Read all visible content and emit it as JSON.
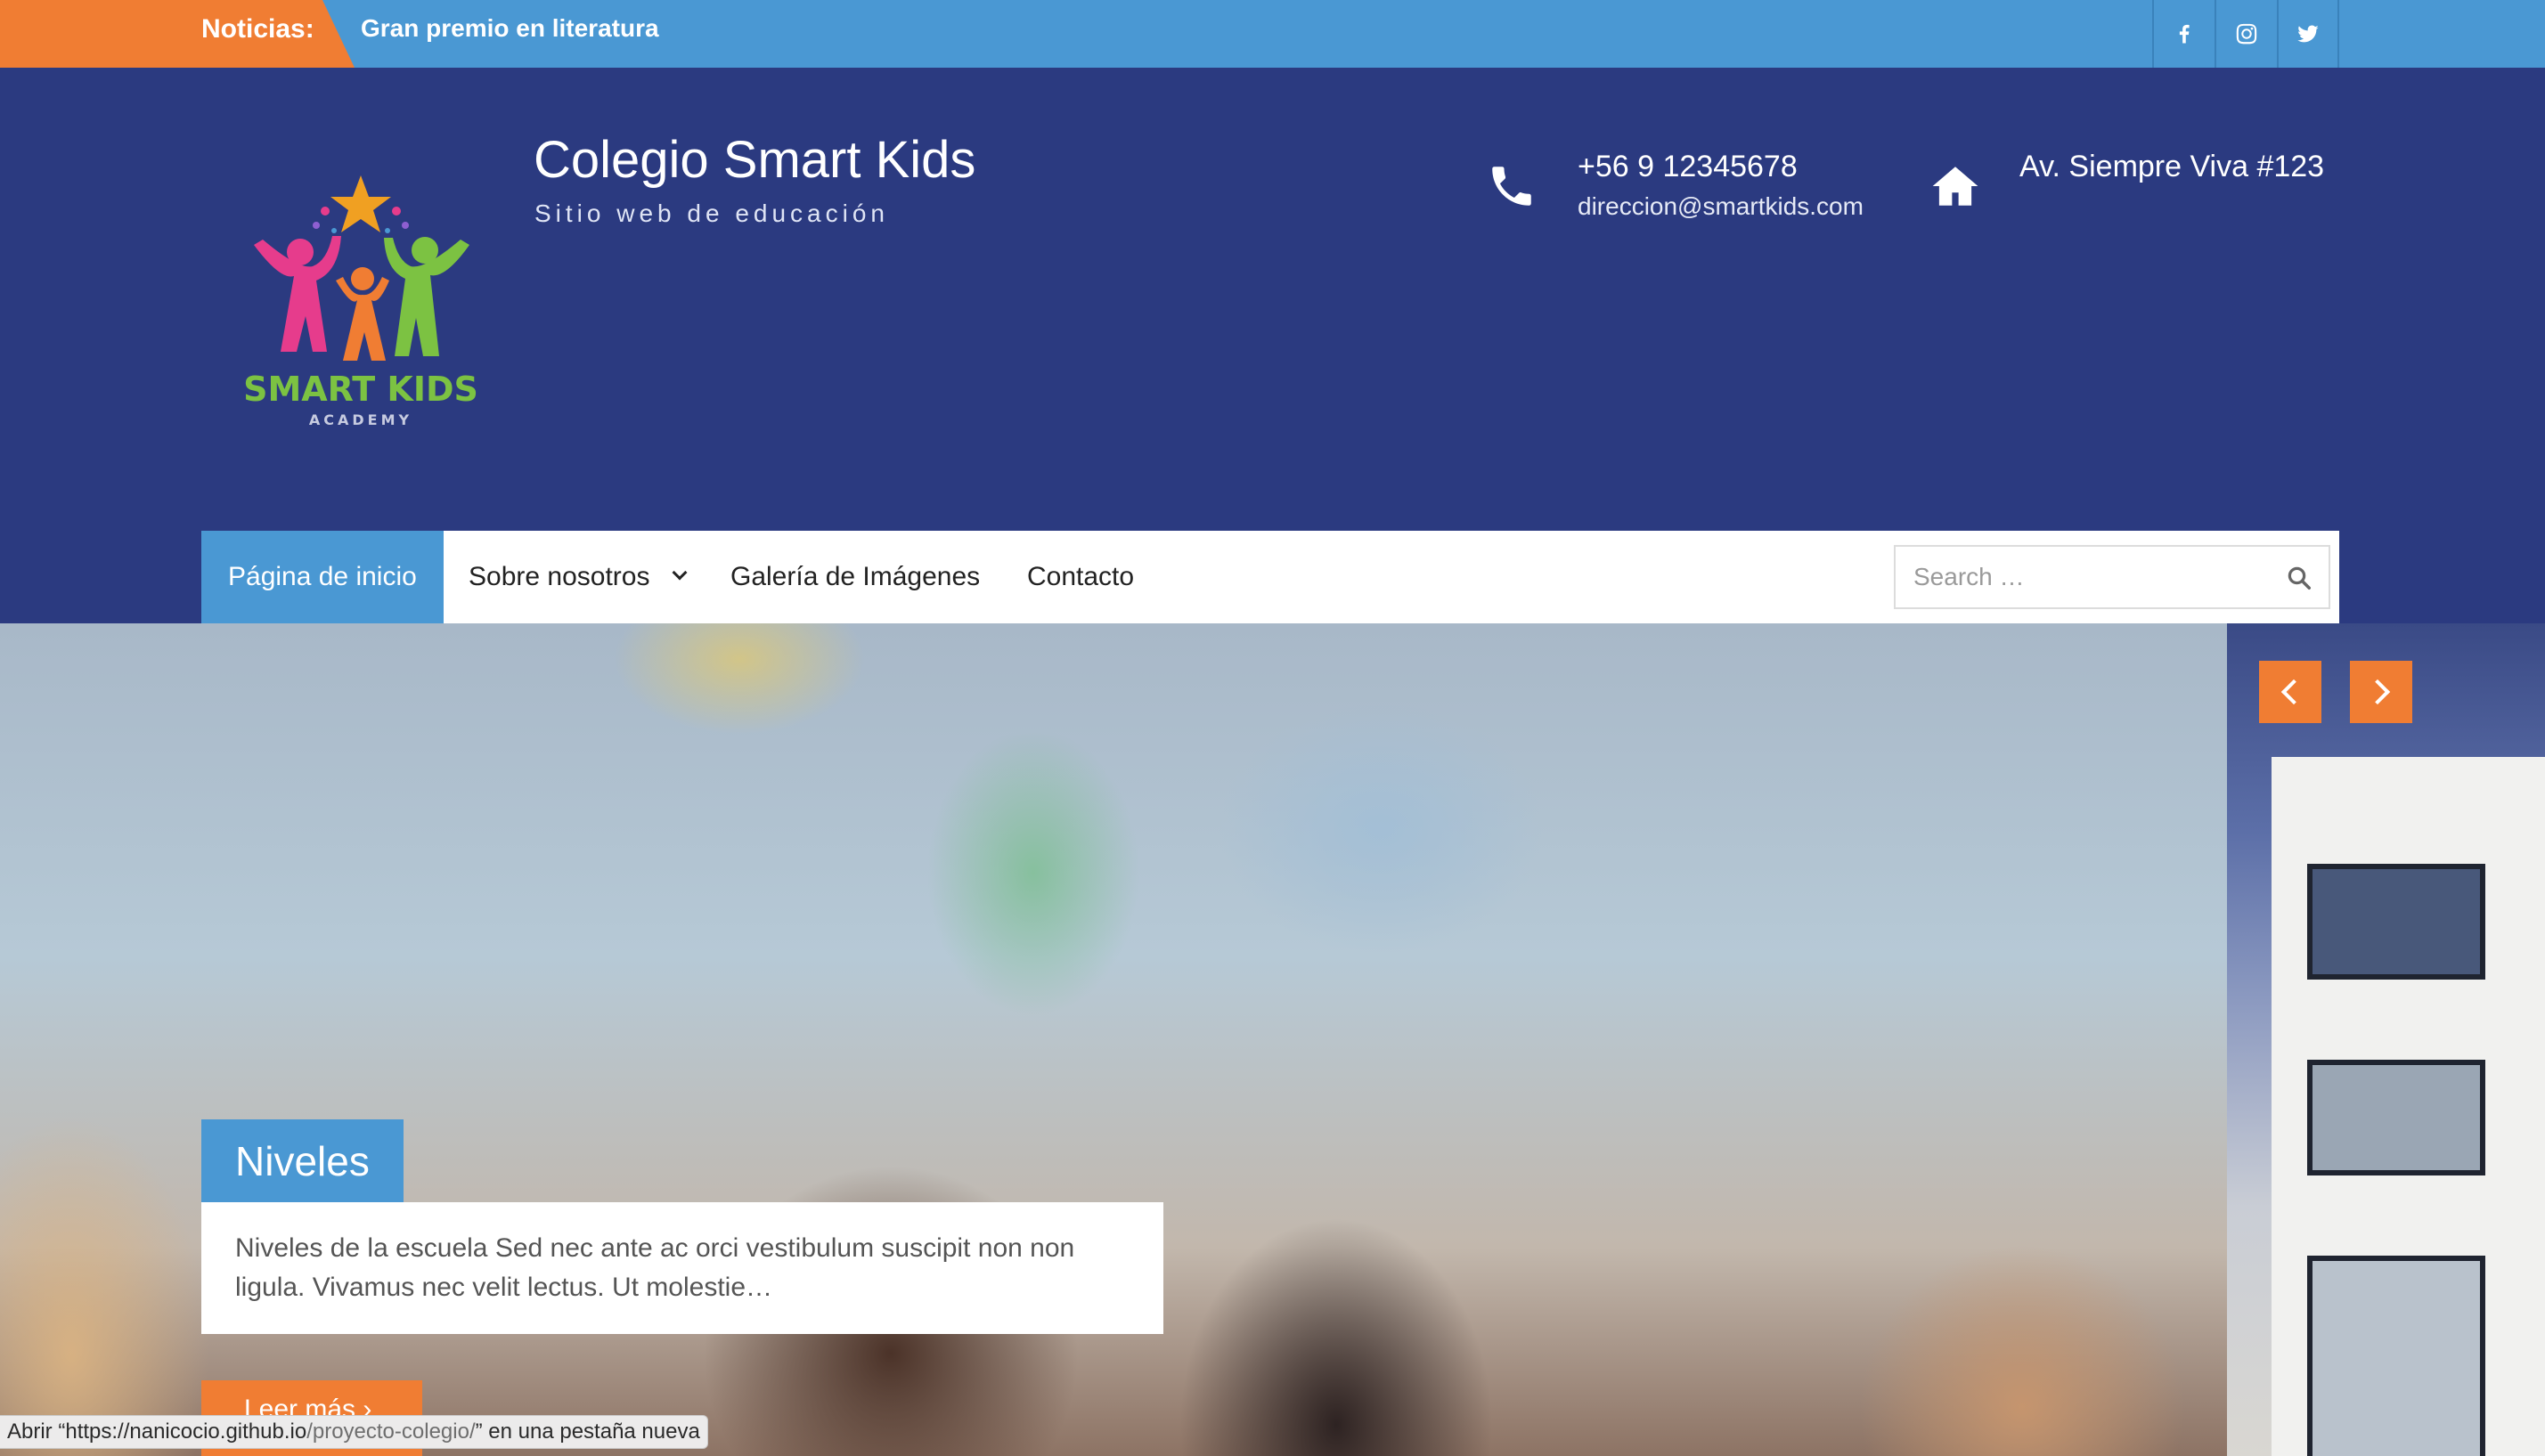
{
  "topbar": {
    "news_label": "Noticias:",
    "news_headline": "Gran premio en literatura",
    "social": [
      {
        "name": "facebook-icon"
      },
      {
        "name": "instagram-icon"
      },
      {
        "name": "twitter-icon"
      }
    ]
  },
  "header": {
    "logo_text": "SMART KIDS",
    "logo_subtext": "ACADEMY",
    "site_title": "Colegio Smart Kids",
    "tagline": "Sitio web de educación",
    "phone": "+56 9 12345678",
    "email": "direccion@smartkids.com",
    "address": "Av. Siempre Viva #123"
  },
  "nav": {
    "items": [
      {
        "label": "Página de inicio",
        "active": true
      },
      {
        "label": "Sobre nosotros",
        "dropdown": true
      },
      {
        "label": "Galería de Imágenes"
      },
      {
        "label": "Contacto"
      }
    ],
    "search_placeholder": "Search …"
  },
  "slider": {
    "caption_title": "Niveles",
    "caption_text": "Niveles de la escuela Sed nec ante ac orci vestibulum suscipit non non ligula. Vivamus nec velit lectus. Ut molestie…",
    "read_more": "Leer más"
  },
  "status_bar": {
    "prefix": "Abrir “",
    "url_host": "https://nanicocio.github.io",
    "url_path": "/proyecto-colegio/",
    "suffix": "” en una pestaña nueva"
  },
  "colors": {
    "header_bg": "#2b3a80",
    "topbar_bg": "#4a98d3",
    "accent_orange": "#f07d33",
    "nav_active": "#4a98d3"
  }
}
